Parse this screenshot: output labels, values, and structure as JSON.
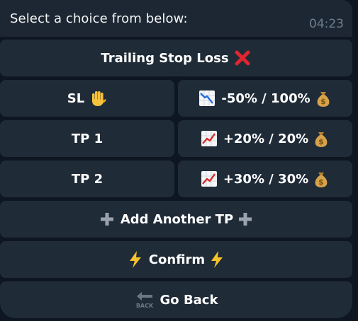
{
  "message": {
    "text": "Select a choice from below:",
    "time": "04:23"
  },
  "buttons": {
    "trailing_stop": {
      "label": "Trailing Stop Loss",
      "icon": "cross-mark-icon"
    },
    "sl": {
      "label": "SL",
      "icon": "raised-hand-icon"
    },
    "sl_value": {
      "label": "-50% / 100%",
      "left_icon": "chart-decreasing-icon",
      "right_icon": "money-bag-icon"
    },
    "tp1": {
      "label": "TP 1"
    },
    "tp1_value": {
      "label": "+20% / 20%",
      "left_icon": "chart-increasing-icon",
      "right_icon": "money-bag-icon"
    },
    "tp2": {
      "label": "TP 2"
    },
    "tp2_value": {
      "label": "+30% / 30%",
      "left_icon": "chart-increasing-icon",
      "right_icon": "money-bag-icon"
    },
    "add_tp": {
      "label": "Add Another TP",
      "icon": "plus-icon"
    },
    "confirm": {
      "label": "Confirm",
      "icon": "lightning-icon"
    },
    "back": {
      "label": "Go Back",
      "icon": "back-arrow-icon",
      "icon_text": "BACK"
    }
  },
  "colors": {
    "background": "#0e1621",
    "bubble": "#1c2733",
    "button": "#202b38",
    "text": "#ffffff",
    "time": "#6d7f8f",
    "cross": "#e0262f",
    "bag": "#c99a3c",
    "bolt": "#f6c22a"
  }
}
